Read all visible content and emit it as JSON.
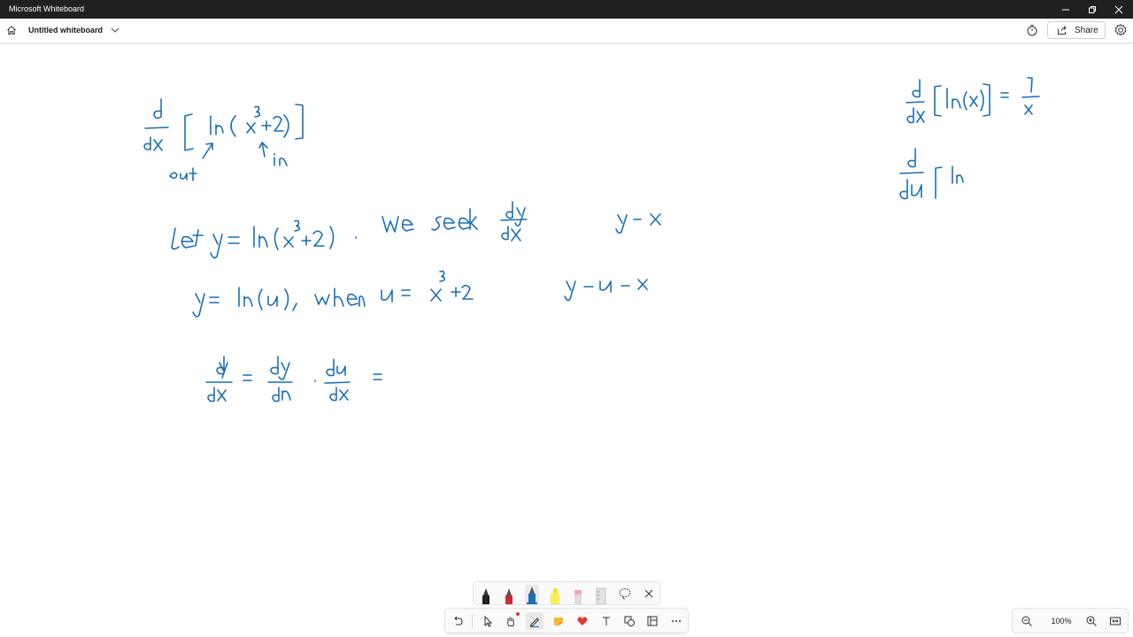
{
  "window": {
    "title": "Microsoft Whiteboard",
    "controls": [
      "minimize",
      "restore",
      "close"
    ]
  },
  "appbar": {
    "home_icon": "home-icon",
    "doc_title": "Untitled whiteboard",
    "share_label": "Share",
    "icons": [
      "timer-icon",
      "share-icon",
      "settings-icon"
    ]
  },
  "board": {
    "ink_color": "#1b6fb5",
    "handwriting": [
      "d/dx [ ln( x³+2) ]",
      "out",
      "in",
      "let y = ln(x³+2) . We seek dy/dx",
      "y = ln(u), when u = x³+2",
      "dy/dx = dy/du · du/dx =",
      "y - x",
      "y - u - x",
      "d/dx [ln(x)] = 1/x",
      "d/du [ ln"
    ]
  },
  "pen_tray": {
    "items": [
      "black-pen",
      "red-pen",
      "blue-pen",
      "yellow-highlighter",
      "pink-eraser",
      "ruler",
      "lasso",
      "close"
    ],
    "selected": "blue-pen"
  },
  "toolbar": {
    "items": [
      "undo",
      "select",
      "hand",
      "pen",
      "sticky-note",
      "reactions",
      "text",
      "shapes",
      "templates",
      "more"
    ],
    "active": "pen"
  },
  "zoom": {
    "level": "100%"
  }
}
